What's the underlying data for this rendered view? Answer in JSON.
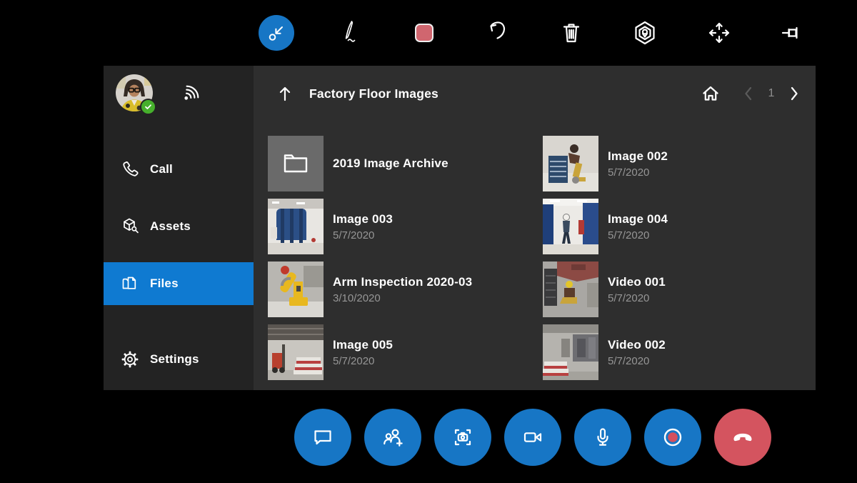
{
  "toolbar": {
    "tools": [
      {
        "name": "arrow-annotation",
        "selected": true
      },
      {
        "name": "ink-annotation",
        "selected": false
      },
      {
        "name": "color-picker",
        "selected": false,
        "swatch_color": "#d0666f"
      },
      {
        "name": "undo",
        "selected": false
      },
      {
        "name": "delete",
        "selected": false
      },
      {
        "name": "spatial-marker",
        "selected": false
      },
      {
        "name": "move",
        "selected": false
      },
      {
        "name": "pin",
        "selected": false
      }
    ]
  },
  "sidebar": {
    "user": {
      "presence": "online",
      "signal_icon": "wifi-signal-icon"
    },
    "items": [
      {
        "label": "Call",
        "icon": "phone-icon",
        "selected": false
      },
      {
        "label": "Assets",
        "icon": "asset-box-wrench-icon",
        "selected": false
      },
      {
        "label": "Files",
        "icon": "files-icon",
        "selected": true
      },
      {
        "label": "Settings",
        "icon": "gear-icon",
        "selected": false
      }
    ]
  },
  "file_browser": {
    "title": "Factory Floor Images",
    "page": "1",
    "items": [
      {
        "name": "2019 Image Archive",
        "date": "",
        "type": "folder"
      },
      {
        "name": "Image 002",
        "date": "5/7/2020",
        "type": "image"
      },
      {
        "name": "Image 003",
        "date": "5/7/2020",
        "type": "image"
      },
      {
        "name": "Image 004",
        "date": "5/7/2020",
        "type": "image"
      },
      {
        "name": "Arm Inspection 2020-03",
        "date": "3/10/2020",
        "type": "image"
      },
      {
        "name": "Video 001",
        "date": "5/7/2020",
        "type": "video"
      },
      {
        "name": "Image 005",
        "date": "5/7/2020",
        "type": "image"
      },
      {
        "name": "Video 002",
        "date": "5/7/2020",
        "type": "video"
      }
    ]
  },
  "call_controls": {
    "buttons": [
      {
        "name": "chat"
      },
      {
        "name": "add-participant"
      },
      {
        "name": "take-photo"
      },
      {
        "name": "video-camera"
      },
      {
        "name": "microphone"
      },
      {
        "name": "record"
      },
      {
        "name": "end-call"
      }
    ]
  },
  "colors": {
    "accent_blue": "#0f7ad1",
    "control_blue": "#1776c5",
    "danger_red": "#d4545f",
    "swatch_red": "#d0666f",
    "online_green": "#46b02c",
    "panel_bg": "#2e2e2e",
    "sidebar_bg": "#232323"
  }
}
